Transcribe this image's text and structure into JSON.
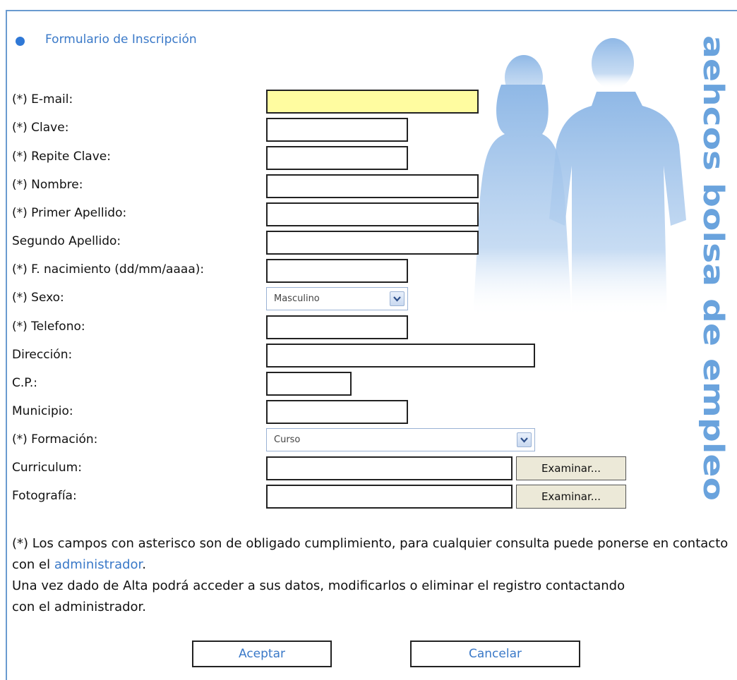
{
  "header": {
    "title": "Formulario de Inscripción"
  },
  "brand": {
    "vertical_text": "aehcos bolsa de empleo"
  },
  "colors": {
    "accent": "#3a79c8",
    "email_highlight": "#fffca0",
    "border": "#6a9bd0"
  },
  "form": {
    "email_label": "(*) E-mail:",
    "email_value": "",
    "clave_label": "(*) Clave:",
    "repite_clave_label": "(*) Repite Clave:",
    "nombre_label": "(*) Nombre:",
    "primer_apellido_label": "(*) Primer Apellido:",
    "segundo_apellido_label": "Segundo Apellido:",
    "nacimiento_label": "(*) F. nacimiento (dd/mm/aaaa):",
    "sexo_label": "(*) Sexo:",
    "sexo_value": "Masculino",
    "telefono_label": "(*) Telefono:",
    "direccion_label": "Dirección:",
    "cp_label": "C.P.:",
    "municipio_label": "Municipio:",
    "formacion_label": "(*) Formación:",
    "formacion_value": "Curso",
    "curriculum_label": "Curriculum:",
    "fotografia_label": "Fotografía:",
    "examinar_label": "Examinar..."
  },
  "notes": {
    "line1_before_link": "(*) Los campos con asterisco son de obligado cumplimiento, para cualquier consulta puede ponerse en contacto con el ",
    "link_text": "administrador",
    "line1_after_link": ".",
    "line2": "Una vez dado de Alta podrá acceder a sus datos, modificarlos o eliminar el registro contactando con el administrador."
  },
  "buttons": {
    "accept_label": "Aceptar",
    "cancel_label": "Cancelar"
  }
}
